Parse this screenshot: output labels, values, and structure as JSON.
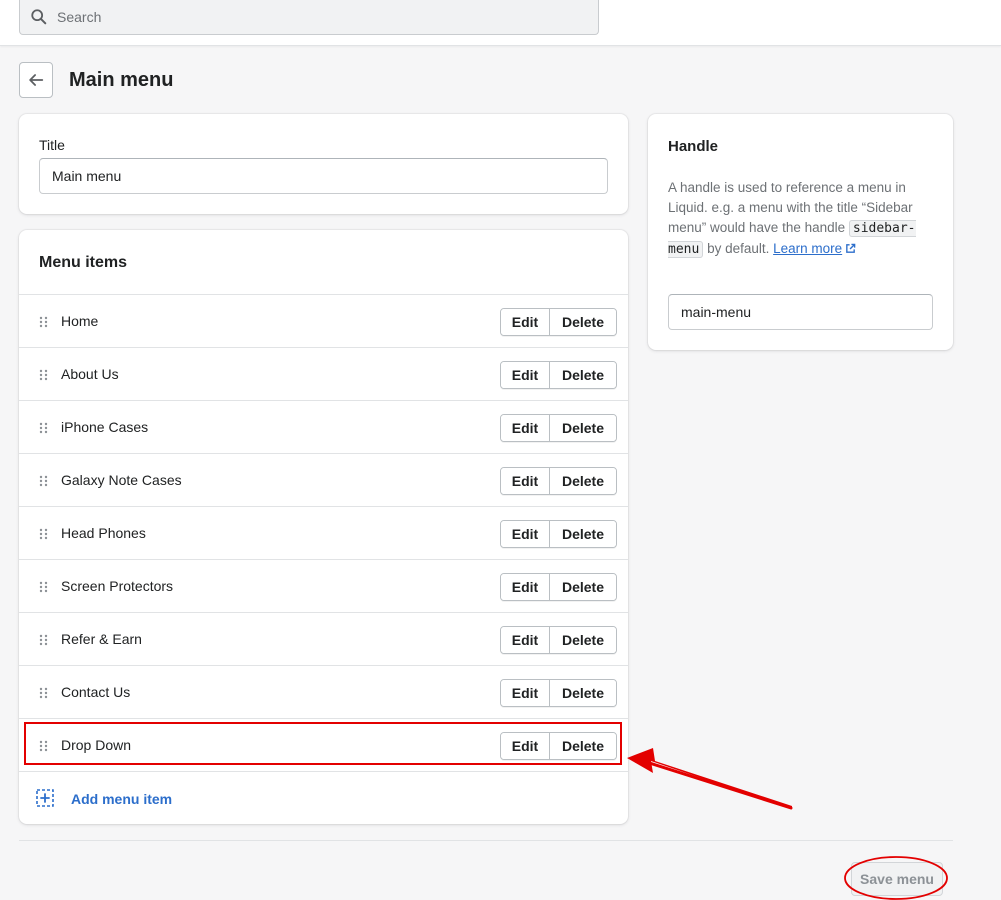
{
  "search": {
    "placeholder": "Search",
    "icon": "search-icon"
  },
  "header": {
    "back_icon": "arrow-left-icon",
    "title": "Main menu"
  },
  "title_card": {
    "label": "Title",
    "value": "Main menu"
  },
  "menu_items": {
    "heading": "Menu items",
    "edit_label": "Edit",
    "delete_label": "Delete",
    "items": [
      {
        "label": "Home"
      },
      {
        "label": "About Us"
      },
      {
        "label": "iPhone Cases"
      },
      {
        "label": "Galaxy Note Cases"
      },
      {
        "label": "Head Phones"
      },
      {
        "label": "Screen Protectors"
      },
      {
        "label": "Refer & Earn"
      },
      {
        "label": "Contact Us"
      },
      {
        "label": "Drop Down"
      }
    ],
    "add_label": "Add menu item"
  },
  "handle_card": {
    "heading": "Handle",
    "help_part1": "A handle is used to reference a menu in Liquid. e.g. a menu with the title “Sidebar menu” would have the handle ",
    "help_code": "sidebar-menu",
    "help_part2": " by default. ",
    "help_link": "Learn more",
    "value": "main-menu"
  },
  "footer": {
    "save_label": "Save menu"
  },
  "colors": {
    "accent": "#2c6ecb",
    "annotation_red": "#e30000",
    "background": "#f6f6f7"
  }
}
